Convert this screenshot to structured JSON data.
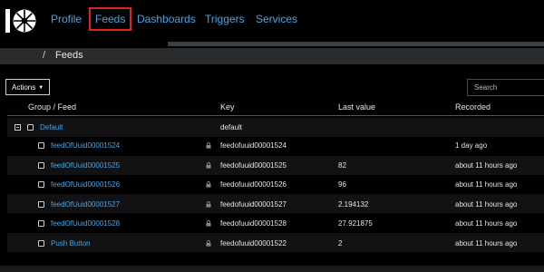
{
  "nav": {
    "items": [
      {
        "label": "Profile",
        "name": "nav-profile"
      },
      {
        "label": "Feeds",
        "name": "nav-feeds",
        "active": true
      },
      {
        "label": "Dashboards",
        "name": "nav-dashboards"
      },
      {
        "label": "Triggers",
        "name": "nav-triggers"
      },
      {
        "label": "Services",
        "name": "nav-services"
      }
    ]
  },
  "breadcrumb": {
    "separator": "/",
    "current": "Feeds"
  },
  "toolbar": {
    "actions_label": "Actions",
    "actions_icon": "caret-down-icon",
    "search_placeholder": "Search"
  },
  "table": {
    "headers": {
      "group": "Group / Feed",
      "key": "Key",
      "last_value": "Last value",
      "recorded": "Recorded"
    },
    "group": {
      "name": "Default",
      "key": "default"
    },
    "rows": [
      {
        "feed": "feedOfUuid00001524",
        "key": "feedofuuid00001524",
        "last_value": "",
        "recorded": "1 day ago"
      },
      {
        "feed": "feedOfUuid00001525",
        "key": "feedofuuid00001525",
        "last_value": "82",
        "recorded": "about 11 hours ago"
      },
      {
        "feed": "feedOfUuid00001526",
        "key": "feedofuuid00001526",
        "last_value": "96",
        "recorded": "about 11 hours ago"
      },
      {
        "feed": "feedOfUuid00001527",
        "key": "feedofuuid00001527",
        "last_value": "2.194132",
        "recorded": "about 11 hours ago"
      },
      {
        "feed": "feedOfUuid00001528",
        "key": "feedofuuid00001528",
        "last_value": "27.921875",
        "recorded": "about 11 hours ago"
      },
      {
        "feed": "Push Button",
        "key": "feedofuuid00001522",
        "last_value": "2",
        "recorded": "about 11 hours ago"
      }
    ]
  },
  "colors": {
    "link": "#4aa3df",
    "active_outline": "#e0241a",
    "background": "#000000"
  }
}
